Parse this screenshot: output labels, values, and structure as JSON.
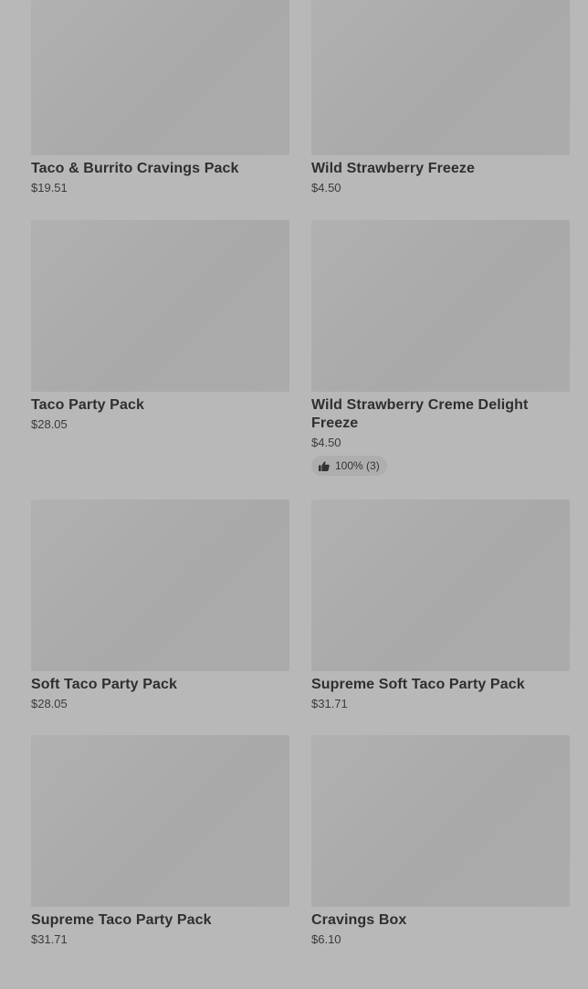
{
  "products": [
    {
      "name": "Taco & Burrito Cravings Pack",
      "price": "$19.51"
    },
    {
      "name": "Wild Strawberry Freeze",
      "price": "$4.50"
    },
    {
      "name": "Taco Party Pack",
      "price": "$28.05"
    },
    {
      "name": "Wild Strawberry Creme Delight Freeze",
      "price": "$4.50",
      "rating": "100% (3)",
      "rating_icon": "thumbs-up-icon"
    },
    {
      "name": "Soft Taco Party Pack",
      "price": "$28.05"
    },
    {
      "name": "Supreme Soft Taco Party Pack",
      "price": "$31.71"
    },
    {
      "name": "Supreme Taco Party Pack",
      "price": "$31.71"
    },
    {
      "name": "Cravings Box",
      "price": "$6.10"
    }
  ]
}
